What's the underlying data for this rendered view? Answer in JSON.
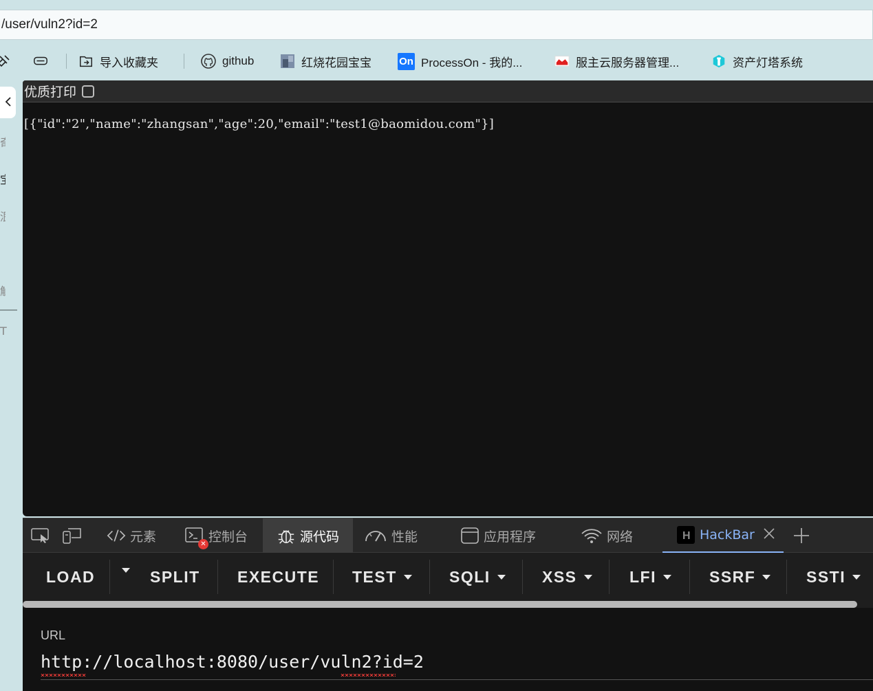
{
  "address_bar": {
    "url": "/user/vuln2?id=2"
  },
  "bookmarks": [
    {
      "icon": "collections-icon",
      "label": ""
    },
    {
      "icon": "import-bookmarks-icon",
      "label": "导入收藏夹"
    },
    {
      "icon": "github-icon",
      "label": "github"
    },
    {
      "icon": "image-icon",
      "label": "红烧花园宝宝"
    },
    {
      "icon": "processon-icon",
      "label": "ProcessOn - 我的..."
    },
    {
      "icon": "server-icon",
      "label": "服主云服务器管理..."
    },
    {
      "icon": "lighthouse-icon",
      "label": "资产灯塔系统"
    }
  ],
  "side_panel": {
    "chars": [
      "奇",
      "宝",
      "泿",
      "触",
      "T"
    ]
  },
  "page": {
    "print_label": "优质打印",
    "json_text": "[{\"id\":\"2\",\"name\":\"zhangsan\",\"age\":20,\"email\":\"test1@baomidou.com\"}]"
  },
  "devtools": {
    "tabs": [
      {
        "icon": "inspect-icon",
        "label": ""
      },
      {
        "icon": "device-toggle-icon",
        "label": ""
      },
      {
        "icon": "elements-icon",
        "label": "元素"
      },
      {
        "icon": "console-icon",
        "label": "控制台"
      },
      {
        "icon": "sources-icon",
        "label": "源代码"
      },
      {
        "icon": "performance-icon",
        "label": "性能"
      },
      {
        "icon": "application-icon",
        "label": "应用程序"
      },
      {
        "icon": "network-icon",
        "label": "网络"
      },
      {
        "icon": "hackbar-icon",
        "label": "HackBar"
      },
      {
        "icon": "add-tab-icon",
        "label": ""
      }
    ],
    "hackbar": {
      "buttons": [
        "LOAD",
        "SPLIT",
        "EXECUTE",
        "TEST",
        "SQLI",
        "XSS",
        "LFI",
        "SSRF",
        "SSTI"
      ],
      "url_label": "URL",
      "url_value": "http://localhost:8080/user/vuln2?id=2"
    }
  },
  "colors": {
    "page_bg": "#121212",
    "accent_blue": "#8ab4f8",
    "chrome_bg": "#cde3e6",
    "error_red": "#e53935"
  }
}
